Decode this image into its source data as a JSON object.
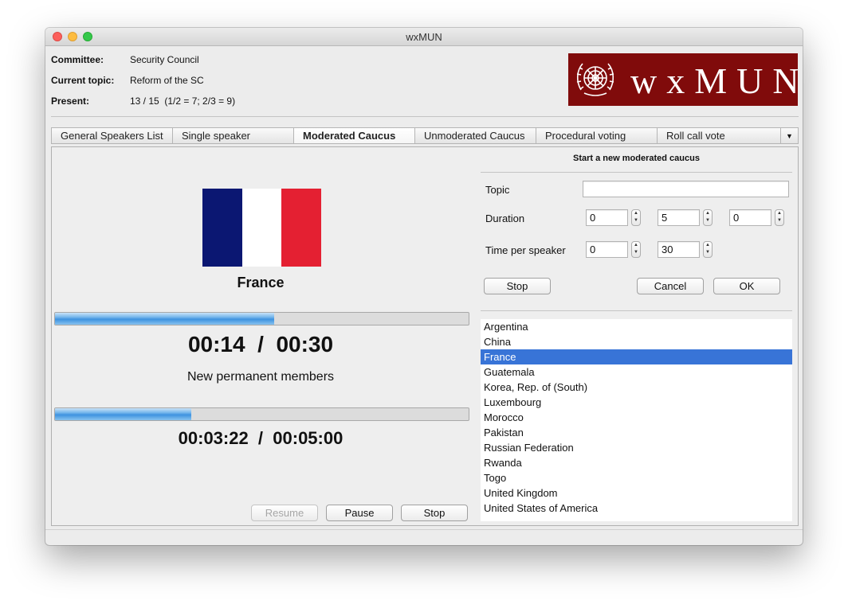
{
  "window": {
    "title": "wxMUN"
  },
  "info": {
    "committee_label": "Committee:",
    "committee_value": "Security Council",
    "topic_label": "Current topic:",
    "topic_value": "Reform of the SC",
    "present_label": "Present:",
    "present_value": "13 / 15  (1/2 = 7; 2/3 = 9)"
  },
  "logo": {
    "text": "wxMUN",
    "icon": "un-emblem-icon"
  },
  "tabs": [
    {
      "label": "General Speakers List"
    },
    {
      "label": "Single speaker"
    },
    {
      "label": "Moderated Caucus",
      "active": true
    },
    {
      "label": "Unmoderated Caucus"
    },
    {
      "label": "Procedural voting"
    },
    {
      "label": "Roll call vote"
    }
  ],
  "tab_overflow_icon": "dropdown-arrow-icon",
  "speaker": {
    "country": "France",
    "flag_colors": [
      "#0b1772",
      "#ffffff",
      "#e42032"
    ],
    "speaker_progress": 0.53,
    "speaker_time": "00:14  /  00:30",
    "caucus_topic": "New permanent members",
    "caucus_progress": 0.33,
    "caucus_time": "00:03:22  /  00:05:00"
  },
  "controls": {
    "resume": "Resume",
    "pause": "Pause",
    "stop": "Stop"
  },
  "form": {
    "header": "Start a new moderated caucus",
    "topic_label": "Topic",
    "topic_value": "",
    "duration_label": "Duration",
    "duration_values": [
      "0",
      "5",
      "0"
    ],
    "time_per_speaker_label": "Time per speaker",
    "time_per_speaker_values": [
      "0",
      "30"
    ],
    "stop_label": "Stop",
    "cancel_label": "Cancel",
    "ok_label": "OK"
  },
  "countries": [
    "Argentina",
    "China",
    "France",
    "Guatemala",
    "Korea, Rep. of (South)",
    "Luxembourg",
    "Morocco",
    "Pakistan",
    "Russian Federation",
    "Rwanda",
    "Togo",
    "United Kingdom",
    "United States of America"
  ],
  "selected_country": "France",
  "colors": {
    "selection": "#3874d7",
    "logo_background": "#800b0b"
  }
}
